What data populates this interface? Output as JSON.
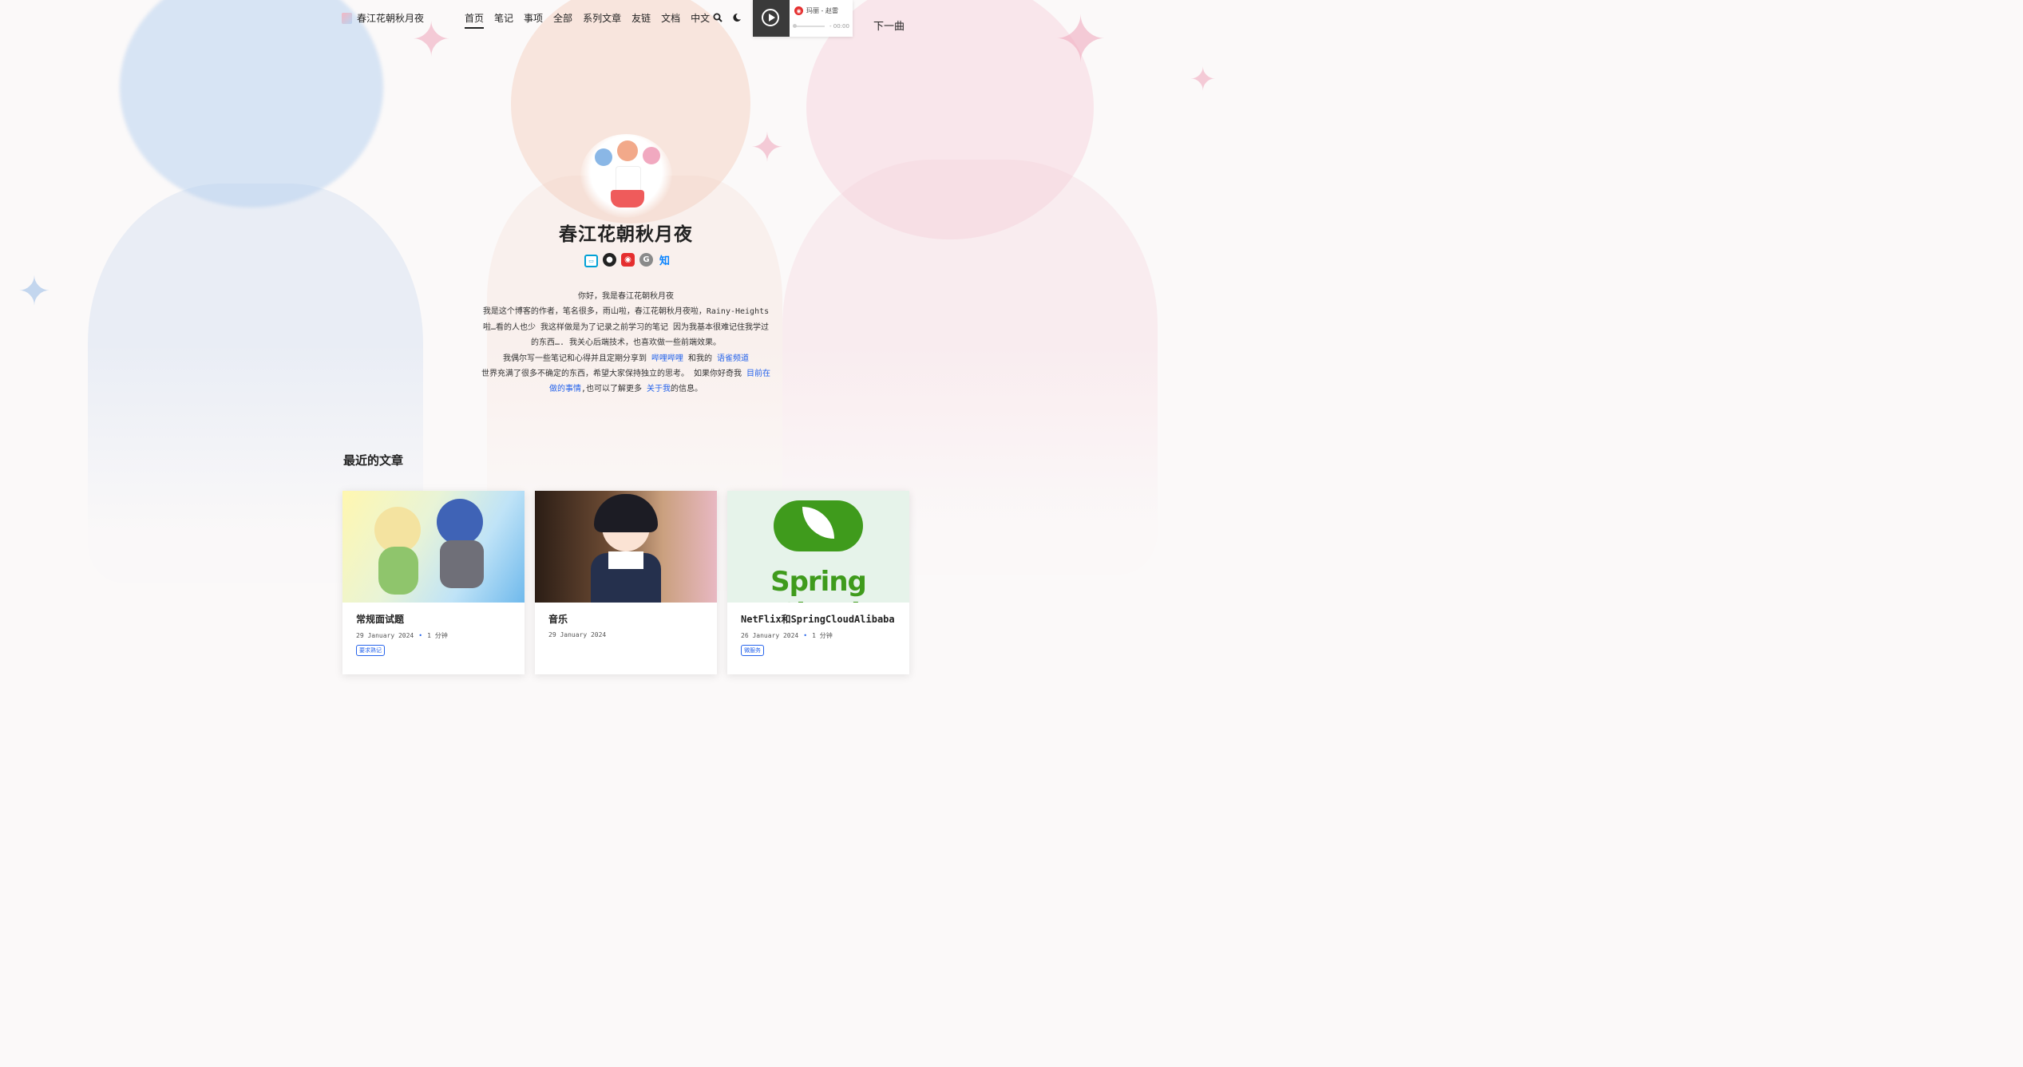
{
  "header": {
    "brand": "春江花朝秋月夜",
    "nav": [
      {
        "label": "首页",
        "active": true
      },
      {
        "label": "笔记",
        "active": false
      },
      {
        "label": "事项",
        "active": false
      },
      {
        "label": "全部",
        "active": false
      },
      {
        "label": "系列文章",
        "active": false
      },
      {
        "label": "友链",
        "active": false
      },
      {
        "label": "文档",
        "active": false
      },
      {
        "label": "中文",
        "active": false
      }
    ],
    "icons": [
      "search-icon",
      "moon-icon"
    ]
  },
  "player": {
    "song": "玛丽 - 赵雷",
    "time": "- 00:00",
    "next_label": "下一曲"
  },
  "hero": {
    "title": "春江花朝秋月夜",
    "socials": [
      "bilibili-icon",
      "github-icon",
      "netease-music-icon",
      "gmail-icon",
      "zhihu-icon"
    ],
    "intro": {
      "line1": "你好，我是春江花朝秋月夜",
      "line2": "我是这个博客的作者，笔名很多，雨山啦，春江花朝秋月夜啦，Rainy-Heights啦…看的人也少 我这样做是为了记录之前学习的笔记 因为我基本很难记住我学过的东西…. 我关心后端技术，也喜欢做一些前端效果。",
      "line3_pre": "我偶尔写一些笔记和心得并且定期分享到",
      "link_bili": "哔哩哔哩",
      "line3_mid": "和我的",
      "link_channel": "语雀频道",
      "line4": "世界充满了很多不确定的东西，希望大家保持独立的思考。 如果你好奇我",
      "link_doing": "目前在做的事情",
      "line4_mid": ",也可以了解更多",
      "link_about": "关于我",
      "line4_end": "的信息。"
    }
  },
  "recent": {
    "title": "最近的文章",
    "posts": [
      {
        "title": "常规面试题",
        "date": "29 January 2024",
        "read": "1 分钟",
        "tag": "要求熟记"
      },
      {
        "title": "音乐",
        "date": "29 January 2024",
        "read": "",
        "tag": ""
      },
      {
        "title": "NetFlix和SpringCloudAlibaba",
        "date": "26 January 2024",
        "read": "1 分钟",
        "tag": "微服务",
        "image_text": "Spring Cloud"
      }
    ]
  },
  "colors": {
    "accent": "#2563eb",
    "netease": "#e52f2f",
    "spring": "#3f9b1c"
  }
}
